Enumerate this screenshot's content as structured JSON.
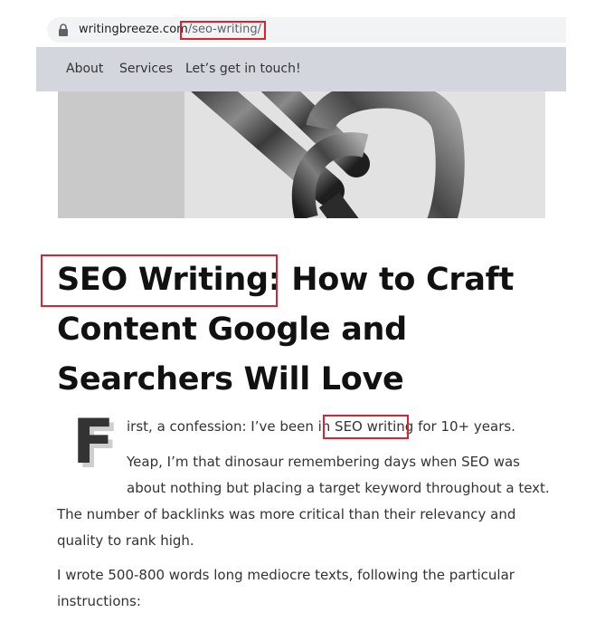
{
  "browser": {
    "url_domain": "writingbreeze.com",
    "url_path": "/seo-writing/"
  },
  "nav": {
    "items": [
      {
        "label": "About"
      },
      {
        "label": "Services"
      },
      {
        "label": "Let’s get in touch!"
      }
    ]
  },
  "hero": {
    "image": "chain-links-photo"
  },
  "article": {
    "title_line1_highlight": "SEO Writing:",
    "title_line1_rest": " How to Craft",
    "title_line2": "Content Google and",
    "title_line3": "Searchers Will Love",
    "dropcap": "F",
    "p1_before": "irst, a confession: I’ve been in ",
    "p1_highlight": "SEO writing",
    "p1_after": " for 10+ years.",
    "p2_line1": "Yeap, I’m that dinosaur remembering days when SEO was",
    "p2_line2": "about nothing but placing a target keyword throughout a text.",
    "p2_line3": "The number of backlinks was more critical than their relevancy and",
    "p2_line4": "quality to rank high.",
    "p3_line1": "I wrote 500-800 words long mediocre texts, following the particular",
    "p3_line2": "instructions:"
  },
  "colors": {
    "highlight_box": "#d9232e",
    "nav_background": "#d3d6dd"
  }
}
